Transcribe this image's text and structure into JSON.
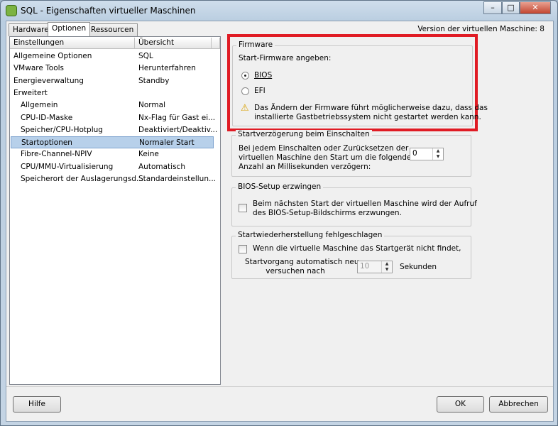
{
  "window": {
    "title": "SQL - Eigenschaften virtueller Maschinen",
    "minimize": "–",
    "maximize": "□",
    "close": "✕"
  },
  "tabs": [
    {
      "label": "Hardware"
    },
    {
      "label": "Optionen"
    },
    {
      "label": "Ressourcen"
    }
  ],
  "version_text": "Version der virtuellen Maschine: 8",
  "list": {
    "headers": [
      "Einstellungen",
      "Übersicht"
    ],
    "rows": [
      {
        "name": "Allgemeine Optionen",
        "value": "SQL"
      },
      {
        "name": "VMware Tools",
        "value": "Herunterfahren"
      },
      {
        "name": "Energieverwaltung",
        "value": "Standby"
      },
      {
        "name": "Erweitert",
        "value": ""
      },
      {
        "name": "Allgemein",
        "value": "Normal"
      },
      {
        "name": "CPU-ID-Maske",
        "value": "Nx-Flag für Gast ei..."
      },
      {
        "name": "Speicher/CPU-Hotplug",
        "value": "Deaktiviert/Deaktiv..."
      },
      {
        "name": "Startoptionen",
        "value": "Normaler Start"
      },
      {
        "name": "Fibre-Channel-NPIV",
        "value": "Keine"
      },
      {
        "name": "CPU/MMU-Virtualisierung",
        "value": "Automatisch"
      },
      {
        "name": "Speicherort der Auslagerungsd...",
        "value": "Standardeinstellun..."
      }
    ]
  },
  "firmware": {
    "legend": "Firmware",
    "prompt": "Start-Firmware angeben:",
    "bios": "BIOS",
    "efi": "EFI",
    "selected": "BIOS",
    "warning_line1": "Das Ändern der Firmware führt möglicherweise dazu, dass das",
    "warning_line2": "installierte Gastbetriebssystem nicht gestartet werden kann.",
    "highlight_color": "#e01b24"
  },
  "delay": {
    "legend": "Startverzögerung beim Einschalten",
    "line1": "Bei jedem Einschalten oder Zurücksetzen der",
    "line2": "virtuellen Maschine den Start um die folgende",
    "line3": "Anzahl an Millisekunden verzögern:",
    "value": "0"
  },
  "bios_setup": {
    "legend": "BIOS-Setup erzwingen",
    "line1": "Beim nächsten Start der virtuellen Maschine wird der Aufruf",
    "line2": "des BIOS-Setup-Bildschirms erzwungen.",
    "checked": false
  },
  "recovery": {
    "legend": "Startwiederherstellung fehlgeschlagen",
    "check_label": "Wenn die virtuelle Maschine das Startgerät nicht findet,",
    "retry_line1": "Startvorgang automatisch neu",
    "retry_line2": "versuchen nach",
    "value": "10",
    "unit": "Sekunden",
    "checked": false
  },
  "buttons": {
    "help": "Hilfe",
    "ok": "OK",
    "cancel": "Abbrechen"
  }
}
